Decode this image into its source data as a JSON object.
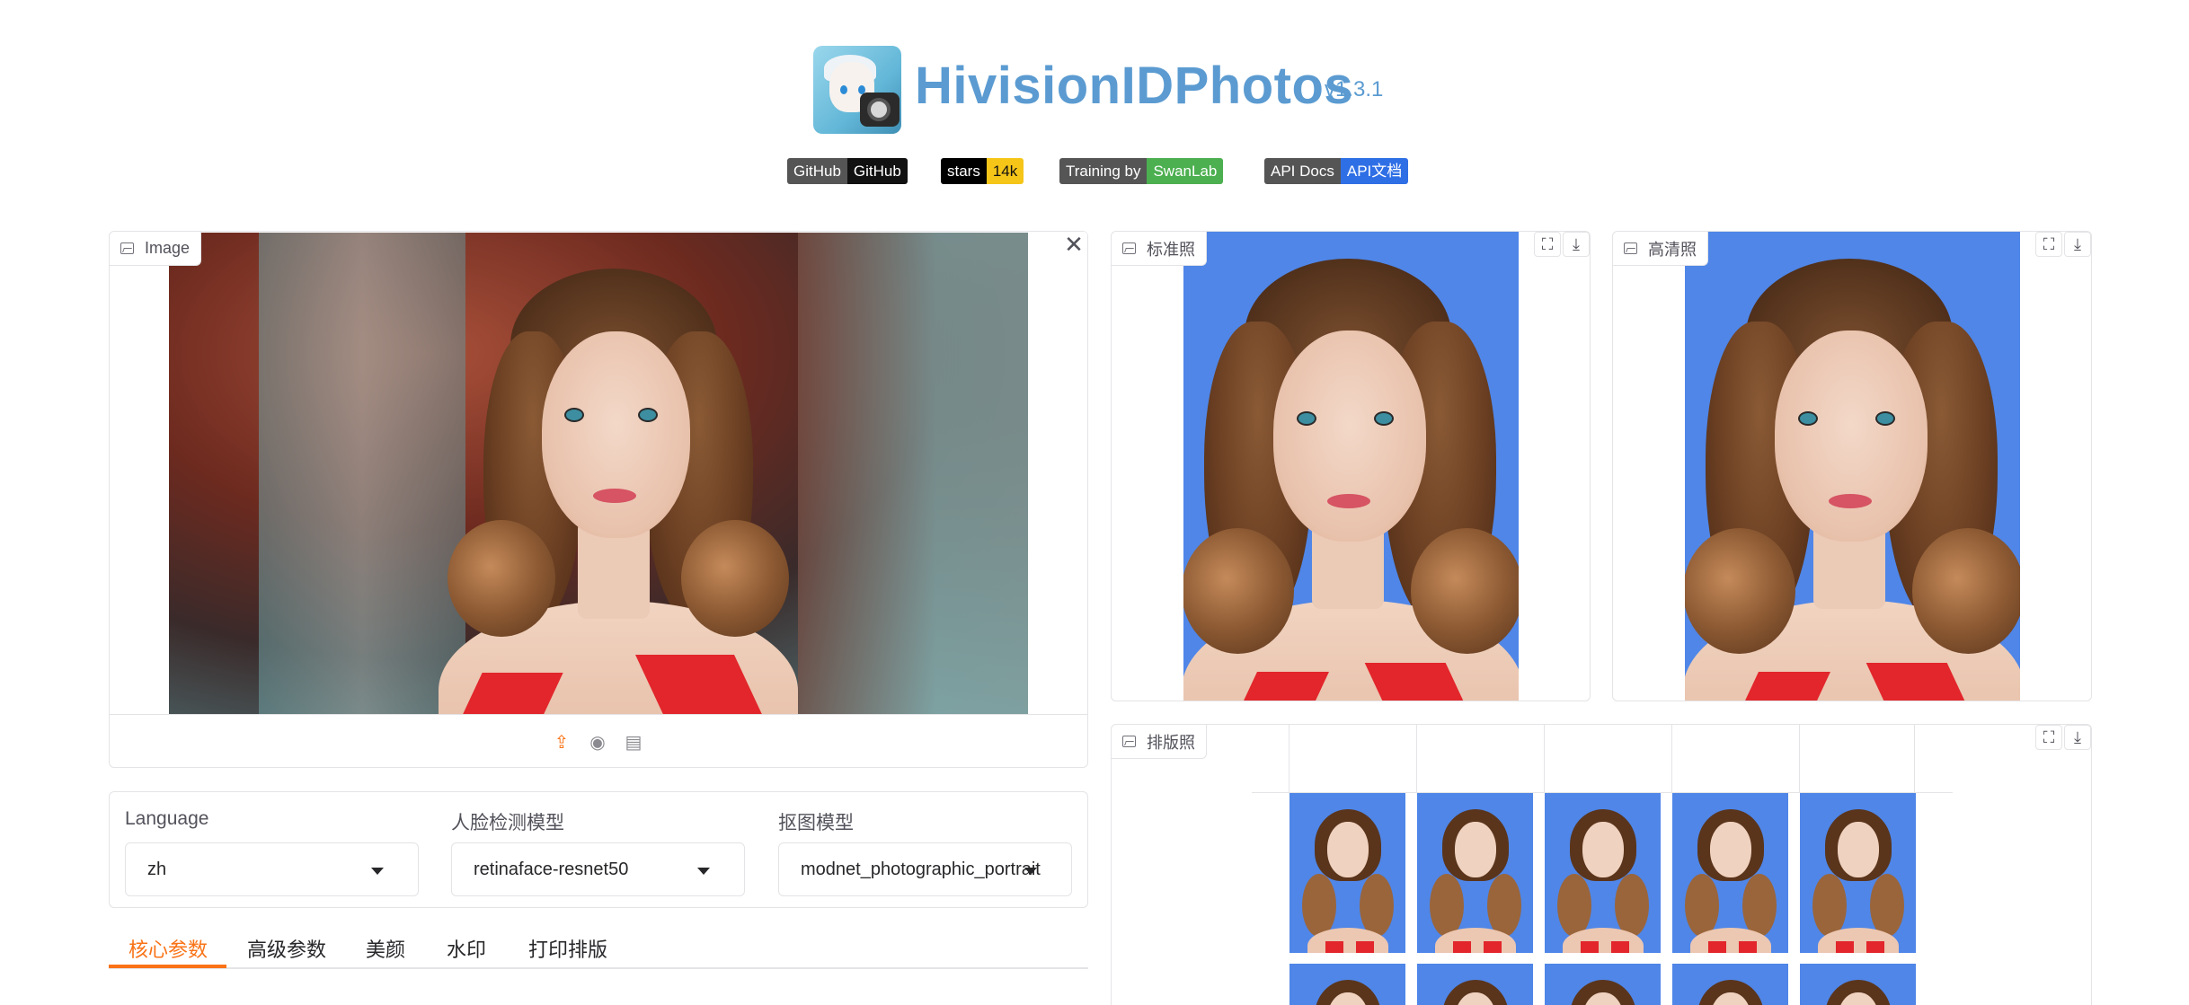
{
  "header": {
    "title": "HivisionIDPhotos",
    "version": "v1.3.1"
  },
  "badges": [
    {
      "left": "GitHub",
      "right": "GitHub",
      "right_color": "#111111"
    },
    {
      "left": "stars",
      "right": "14k",
      "right_color": "#f5c518"
    },
    {
      "left": "Training by",
      "right": "SwanLab",
      "right_color": "#4caf50"
    },
    {
      "left": "API Docs",
      "right": "API文档",
      "right_color": "#2f6fe6"
    }
  ],
  "input_panel": {
    "label": "Image"
  },
  "standard_panel": {
    "label": "标准照"
  },
  "hd_panel": {
    "label": "高清照"
  },
  "layout_panel": {
    "label": "排版照"
  },
  "settings": {
    "language": {
      "label": "Language",
      "value": "zh"
    },
    "face_model": {
      "label": "人脸检测模型",
      "value": "retinaface-resnet50"
    },
    "matting_model": {
      "label": "抠图模型",
      "value": "modnet_photographic_portrait"
    }
  },
  "tabs": [
    "核心参数",
    "高级参数",
    "美颜",
    "水印",
    "打印排版"
  ],
  "active_tab": "核心参数",
  "colors": {
    "accent": "#f97316",
    "id_background": "#4f86e8",
    "title": "#5b9bd1"
  },
  "icons": {
    "close": "close-icon",
    "fullscreen": "fullscreen-icon",
    "download": "download-icon",
    "upload": "upload-icon",
    "webcam": "webcam-icon",
    "clipboard": "clipboard-icon"
  }
}
